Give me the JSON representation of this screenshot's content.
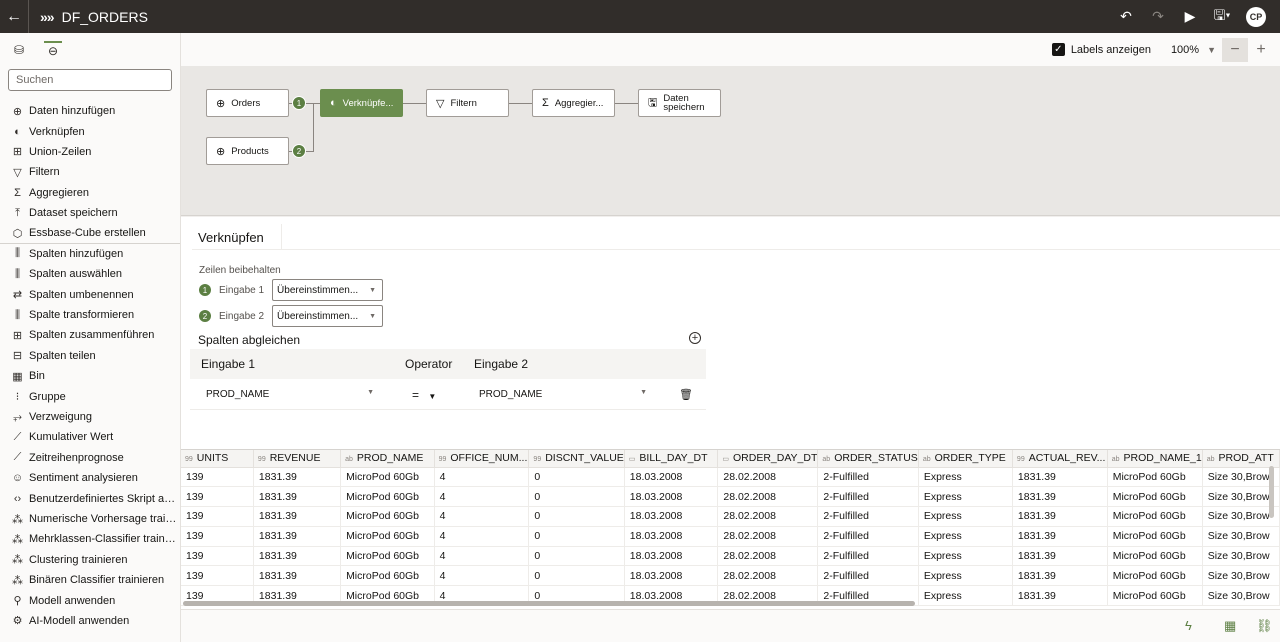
{
  "topbar": {
    "title": "DF_ORDERS",
    "logo": "»»",
    "user_initials": "CP"
  },
  "sidebar": {
    "search_placeholder": "Suchen",
    "items": [
      {
        "icon": "⊕",
        "label": "Daten hinzufügen"
      },
      {
        "icon": "◐",
        "label": "Verknüpfen"
      },
      {
        "icon": "⊞",
        "label": "Union-Zeilen"
      },
      {
        "icon": "▽",
        "label": "Filtern"
      },
      {
        "icon": "Σ",
        "label": "Aggregieren"
      },
      {
        "icon": "⤒",
        "label": "Dataset speichern"
      },
      {
        "icon": "⬡",
        "label": "Essbase-Cube erstellen"
      },
      {
        "icon": "⫼",
        "label": "Spalten hinzufügen"
      },
      {
        "icon": "⫼",
        "label": "Spalten auswählen"
      },
      {
        "icon": "⇄",
        "label": "Spalten umbenennen"
      },
      {
        "icon": "⫼",
        "label": "Spalte transformieren"
      },
      {
        "icon": "⊞",
        "label": "Spalten zusammenführen"
      },
      {
        "icon": "⊟",
        "label": "Spalten teilen"
      },
      {
        "icon": "▦",
        "label": "Bin"
      },
      {
        "icon": "⁝",
        "label": "Gruppe"
      },
      {
        "icon": "⥅",
        "label": "Verzweigung"
      },
      {
        "icon": "⟋",
        "label": "Kumulativer Wert"
      },
      {
        "icon": "⟋",
        "label": "Zeitreihenprognose"
      },
      {
        "icon": "☺",
        "label": "Sentiment analysieren"
      },
      {
        "icon": "‹›",
        "label": "Benutzerdefiniertes Skript a…"
      },
      {
        "icon": "⁂",
        "label": "Numerische Vorhersage trai…"
      },
      {
        "icon": "⁂",
        "label": "Mehrklassen-Classifier train…"
      },
      {
        "icon": "⁂",
        "label": "Clustering trainieren"
      },
      {
        "icon": "⁂",
        "label": "Binären Classifier trainieren"
      },
      {
        "icon": "⚲",
        "label": "Modell anwenden"
      },
      {
        "icon": "⚙",
        "label": "AI-Modell anwenden"
      }
    ]
  },
  "toolbar": {
    "labels_checkbox": "Labels anzeigen",
    "zoom": "100%",
    "zoom_out": "−",
    "zoom_in": "+"
  },
  "flow": {
    "nodes": {
      "orders": {
        "label": "Orders",
        "icon": "⊕"
      },
      "products": {
        "label": "Products",
        "icon": "⊕"
      },
      "join": {
        "label": "Verknüpfe...",
        "icon": "◐"
      },
      "filter": {
        "label": "Filtern",
        "icon": "▽"
      },
      "aggregate": {
        "label": "Aggregier...",
        "icon": "Σ"
      },
      "save": {
        "label": "Daten speichern",
        "label_line1": "Daten",
        "label_line2": "speichern",
        "icon": "💾"
      }
    },
    "badge1": "1",
    "badge2": "2"
  },
  "props": {
    "title": "Verknüpfen",
    "keep_rows_label": "Zeilen beibehalten",
    "input1_label": "Eingabe 1",
    "input2_label": "Eingabe 2",
    "input1_value": "Übereinstimmen...",
    "input2_value": "Übereinstimmen...",
    "match_columns_title": "Spalten abgleichen",
    "match_head": {
      "input1": "Eingabe 1",
      "operator": "Operator",
      "input2": "Eingabe 2"
    },
    "match_row": {
      "input1": "PROD_NAME",
      "operator": "=",
      "input2": "PROD_NAME"
    }
  },
  "grid": {
    "columns": [
      {
        "type": "99",
        "name": "UNITS"
      },
      {
        "type": "99",
        "name": "REVENUE"
      },
      {
        "type": "ab",
        "name": "PROD_NAME"
      },
      {
        "type": "99",
        "name": "OFFICE_NUM..."
      },
      {
        "type": "99",
        "name": "DISCNT_VALUE"
      },
      {
        "type": "▭",
        "name": "BILL_DAY_DT"
      },
      {
        "type": "▭",
        "name": "ORDER_DAY_DT"
      },
      {
        "type": "ab",
        "name": "ORDER_STATUS"
      },
      {
        "type": "ab",
        "name": "ORDER_TYPE"
      },
      {
        "type": "99",
        "name": "ACTUAL_REV..."
      },
      {
        "type": "ab",
        "name": "PROD_NAME_1"
      },
      {
        "type": "ab",
        "name": "PROD_ATT"
      }
    ],
    "rows": [
      [
        "139",
        "1831.39",
        "MicroPod 60Gb",
        "4",
        "0",
        "18.03.2008",
        "28.02.2008",
        "2-Fulfilled",
        "Express",
        "1831.39",
        "MicroPod 60Gb",
        "Size 30,Brow"
      ],
      [
        "139",
        "1831.39",
        "MicroPod 60Gb",
        "4",
        "0",
        "18.03.2008",
        "28.02.2008",
        "2-Fulfilled",
        "Express",
        "1831.39",
        "MicroPod 60Gb",
        "Size 30,Brow"
      ],
      [
        "139",
        "1831.39",
        "MicroPod 60Gb",
        "4",
        "0",
        "18.03.2008",
        "28.02.2008",
        "2-Fulfilled",
        "Express",
        "1831.39",
        "MicroPod 60Gb",
        "Size 30,Brow"
      ],
      [
        "139",
        "1831.39",
        "MicroPod 60Gb",
        "4",
        "0",
        "18.03.2008",
        "28.02.2008",
        "2-Fulfilled",
        "Express",
        "1831.39",
        "MicroPod 60Gb",
        "Size 30,Brow"
      ],
      [
        "139",
        "1831.39",
        "MicroPod 60Gb",
        "4",
        "0",
        "18.03.2008",
        "28.02.2008",
        "2-Fulfilled",
        "Express",
        "1831.39",
        "MicroPod 60Gb",
        "Size 30,Brow"
      ],
      [
        "139",
        "1831.39",
        "MicroPod 60Gb",
        "4",
        "0",
        "18.03.2008",
        "28.02.2008",
        "2-Fulfilled",
        "Express",
        "1831.39",
        "MicroPod 60Gb",
        "Size 30,Brow"
      ],
      [
        "139",
        "1831.39",
        "MicroPod 60Gb",
        "4",
        "0",
        "18.03.2008",
        "28.02.2008",
        "2-Fulfilled",
        "Express",
        "1831.39",
        "MicroPod 60Gb",
        "Size 30,Brow"
      ]
    ]
  },
  "colors": {
    "accent": "#6b8e4e",
    "topbar": "#312d2a"
  }
}
